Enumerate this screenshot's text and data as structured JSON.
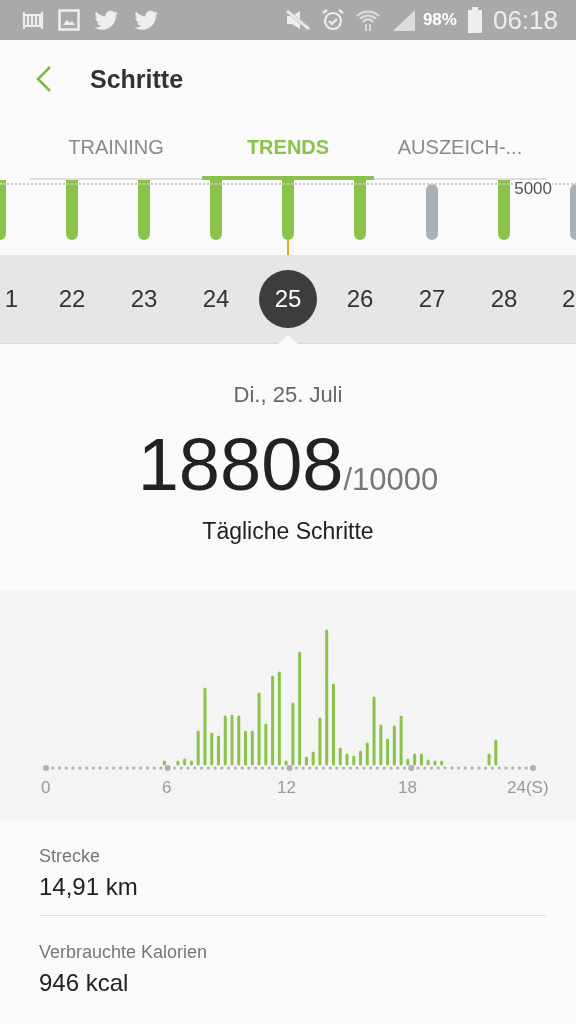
{
  "status_bar": {
    "battery": "98%",
    "time": "06:18"
  },
  "header": {
    "title": "Schritte"
  },
  "tabs": [
    {
      "label": "TRAINING",
      "selected": false
    },
    {
      "label": "TRENDS",
      "selected": true
    },
    {
      "label": "AUSZEICH-...",
      "selected": false
    }
  ],
  "week_chart": {
    "goal_label": "5000"
  },
  "days": [
    {
      "label": "1",
      "goal_reached": true,
      "selected": false
    },
    {
      "label": "22",
      "goal_reached": true,
      "selected": false
    },
    {
      "label": "23",
      "goal_reached": true,
      "selected": false
    },
    {
      "label": "24",
      "goal_reached": true,
      "selected": false
    },
    {
      "label": "25",
      "goal_reached": true,
      "selected": true
    },
    {
      "label": "26",
      "goal_reached": true,
      "selected": false
    },
    {
      "label": "27",
      "goal_reached": false,
      "selected": false
    },
    {
      "label": "28",
      "goal_reached": true,
      "selected": false
    },
    {
      "label": "2",
      "goal_reached": false,
      "selected": false
    }
  ],
  "summary": {
    "date": "Di., 25. Juli",
    "steps": "18808",
    "goal": "/10000",
    "caption": "Tägliche Schritte"
  },
  "hourly_chart": {
    "axis_labels": [
      "0",
      "6",
      "12",
      "18",
      "24(S)"
    ]
  },
  "stats": [
    {
      "label": "Strecke",
      "value": "14,91 km"
    },
    {
      "label": "Verbrauchte Kalorien",
      "value": "946 kcal"
    }
  ]
}
